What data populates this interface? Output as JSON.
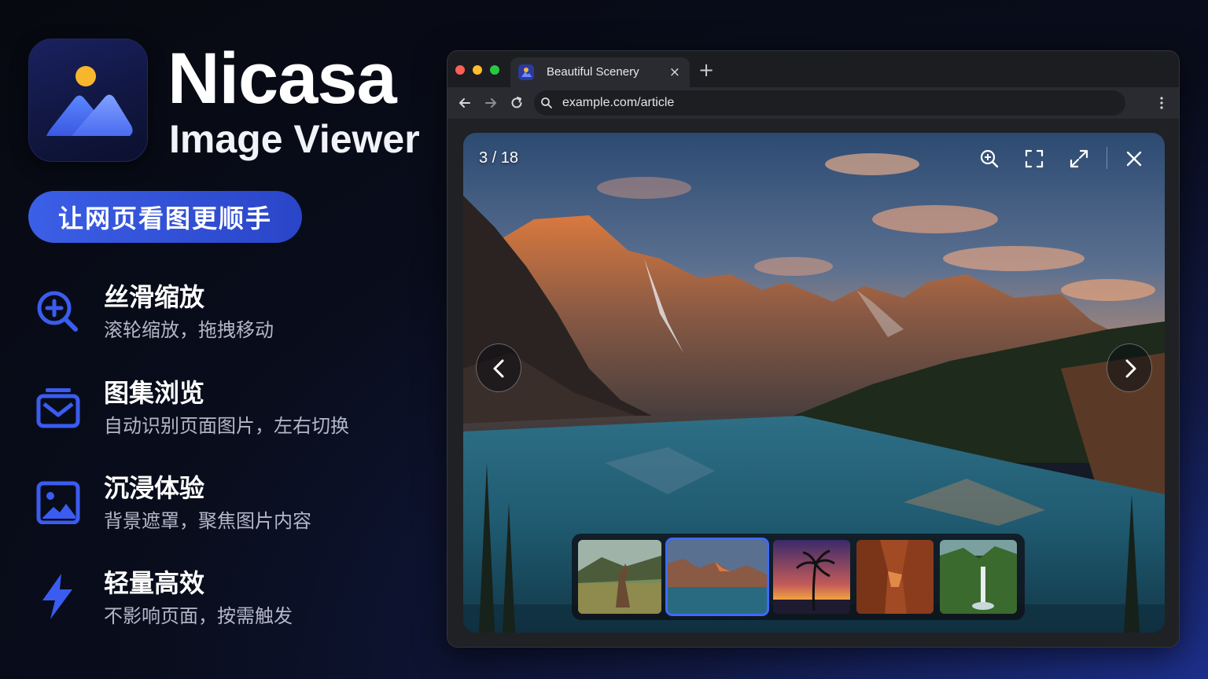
{
  "brand": {
    "name": "Nicasa",
    "subtitle": "Image Viewer",
    "tagline": "让网页看图更顺手",
    "icon": "mountain-sun-icon"
  },
  "features": [
    {
      "icon": "zoom-in-icon",
      "title": "丝滑缩放",
      "desc": "滚轮缩放，拖拽移动"
    },
    {
      "icon": "gallery-icon",
      "title": "图集浏览",
      "desc": "自动识别页面图片，左右切换"
    },
    {
      "icon": "image-icon",
      "title": "沉浸体验",
      "desc": "背景遮罩，聚焦图片内容"
    },
    {
      "icon": "lightning-icon",
      "title": "轻量高效",
      "desc": "不影响页面，按需触发"
    }
  ],
  "browser": {
    "tab_title": "Beautiful Scenery",
    "tab_close": "×",
    "new_tab": "+",
    "url": "example.com/article"
  },
  "viewer": {
    "counter": "3 / 18",
    "current_index": 3,
    "total": 18,
    "tools": [
      "zoom-in-icon",
      "fullscreen-icon",
      "expand-icon",
      "close-icon"
    ],
    "thumbnails": [
      {
        "subject": "kangaroo-meadow",
        "active": false
      },
      {
        "subject": "mountain-lake",
        "active": true
      },
      {
        "subject": "palm-sunset",
        "active": false
      },
      {
        "subject": "red-canyon",
        "active": false
      },
      {
        "subject": "jungle-waterfall",
        "active": false
      }
    ]
  },
  "colors": {
    "accent": "#3b5fe6",
    "active_border": "#3d6bff",
    "traffic_red": "#fe5f57",
    "traffic_yellow": "#febc2e",
    "traffic_green": "#28c840"
  }
}
